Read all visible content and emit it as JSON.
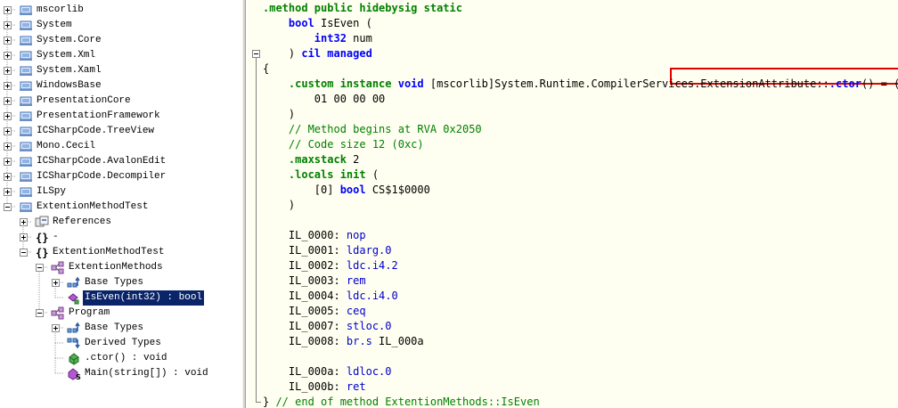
{
  "tree": {
    "items": [
      {
        "label": "mscorlib",
        "icon": "assembly-icon"
      },
      {
        "label": "System",
        "icon": "assembly-icon"
      },
      {
        "label": "System.Core",
        "icon": "assembly-icon"
      },
      {
        "label": "System.Xml",
        "icon": "assembly-icon"
      },
      {
        "label": "System.Xaml",
        "icon": "assembly-icon"
      },
      {
        "label": "WindowsBase",
        "icon": "assembly-icon"
      },
      {
        "label": "PresentationCore",
        "icon": "assembly-icon"
      },
      {
        "label": "PresentationFramework",
        "icon": "assembly-icon"
      },
      {
        "label": "ICSharpCode.TreeView",
        "icon": "assembly-icon"
      },
      {
        "label": "Mono.Cecil",
        "icon": "assembly-icon"
      },
      {
        "label": "ICSharpCode.AvalonEdit",
        "icon": "assembly-icon"
      },
      {
        "label": "ICSharpCode.Decompiler",
        "icon": "assembly-icon"
      },
      {
        "label": "ILSpy",
        "icon": "assembly-icon"
      },
      {
        "label": "ExtentionMethodTest",
        "icon": "assembly-icon"
      },
      {
        "label": "References",
        "icon": "references-icon"
      },
      {
        "label": "-",
        "icon": "namespace-icon"
      },
      {
        "label": "ExtentionMethodTest",
        "icon": "namespace-icon"
      },
      {
        "label": "ExtentionMethods",
        "icon": "class-icon"
      },
      {
        "label": "Base Types",
        "icon": "base-types-icon"
      },
      {
        "label": "IsEven(int32) : bool",
        "icon": "extension-method-icon",
        "selected": true
      },
      {
        "label": "Program",
        "icon": "class-icon"
      },
      {
        "label": "Base Types",
        "icon": "base-types-icon"
      },
      {
        "label": "Derived Types",
        "icon": "derived-types-icon"
      },
      {
        "label": ".ctor() : void",
        "icon": "method-icon"
      },
      {
        "label": "Main(string[]) : void",
        "icon": "static-method-icon"
      }
    ]
  },
  "code": {
    "lines": [
      [
        {
          "t": ".method public hidebysig static",
          "c": "kw"
        }
      ],
      [
        {
          "t": "    "
        },
        {
          "t": "bool",
          "c": "ty"
        },
        {
          "t": " IsEven ("
        }
      ],
      [
        {
          "t": "        "
        },
        {
          "t": "int32",
          "c": "ty"
        },
        {
          "t": " num"
        }
      ],
      [
        {
          "t": "    ) "
        },
        {
          "t": "cil managed",
          "c": "ty"
        }
      ],
      [
        {
          "t": "{"
        }
      ],
      [
        {
          "t": "    "
        },
        {
          "t": ".custom instance",
          "c": "kw"
        },
        {
          "t": " "
        },
        {
          "t": "void",
          "c": "ty"
        },
        {
          "t": " [mscorlib]System.Runtime.CompilerServices.ExtensionAttribute::"
        },
        {
          "t": ".ctor",
          "c": "ty"
        },
        {
          "t": "() = ("
        }
      ],
      [
        {
          "t": "        01 00 00 00"
        }
      ],
      [
        {
          "t": "    )"
        }
      ],
      [
        {
          "t": "    // Method begins at RVA 0x2050",
          "c": "cm"
        }
      ],
      [
        {
          "t": "    // Code size 12 (0xc)",
          "c": "cm"
        }
      ],
      [
        {
          "t": "    "
        },
        {
          "t": ".maxstack",
          "c": "kw"
        },
        {
          "t": " 2"
        }
      ],
      [
        {
          "t": "    "
        },
        {
          "t": ".locals init",
          "c": "kw"
        },
        {
          "t": " ("
        }
      ],
      [
        {
          "t": "        [0] "
        },
        {
          "t": "bool",
          "c": "ty"
        },
        {
          "t": " CS$1$0000"
        }
      ],
      [
        {
          "t": "    )"
        }
      ],
      [
        {
          "t": ""
        }
      ],
      [
        {
          "t": "    IL_0000: "
        },
        {
          "t": "nop",
          "c": "op"
        }
      ],
      [
        {
          "t": "    IL_0001: "
        },
        {
          "t": "ldarg.0",
          "c": "op"
        }
      ],
      [
        {
          "t": "    IL_0002: "
        },
        {
          "t": "ldc.i4.2",
          "c": "op"
        }
      ],
      [
        {
          "t": "    IL_0003: "
        },
        {
          "t": "rem",
          "c": "op"
        }
      ],
      [
        {
          "t": "    IL_0004: "
        },
        {
          "t": "ldc.i4.0",
          "c": "op"
        }
      ],
      [
        {
          "t": "    IL_0005: "
        },
        {
          "t": "ceq",
          "c": "op"
        }
      ],
      [
        {
          "t": "    IL_0007: "
        },
        {
          "t": "stloc.0",
          "c": "op"
        }
      ],
      [
        {
          "t": "    IL_0008: "
        },
        {
          "t": "br.s",
          "c": "op"
        },
        {
          "t": " IL_000a"
        }
      ],
      [
        {
          "t": ""
        }
      ],
      [
        {
          "t": "    IL_000a: "
        },
        {
          "t": "ldloc.0",
          "c": "op"
        }
      ],
      [
        {
          "t": "    IL_000b: "
        },
        {
          "t": "ret",
          "c": "op"
        }
      ],
      [
        {
          "t": "} "
        },
        {
          "t": "// end of method ExtentionMethods::IsEven",
          "c": "cm"
        }
      ]
    ]
  },
  "colors": {
    "selection": "#0a246a",
    "code_background": "#fffff1",
    "keyword": "#008000",
    "type": "#0000ff",
    "highlight_box": "#e00000"
  }
}
